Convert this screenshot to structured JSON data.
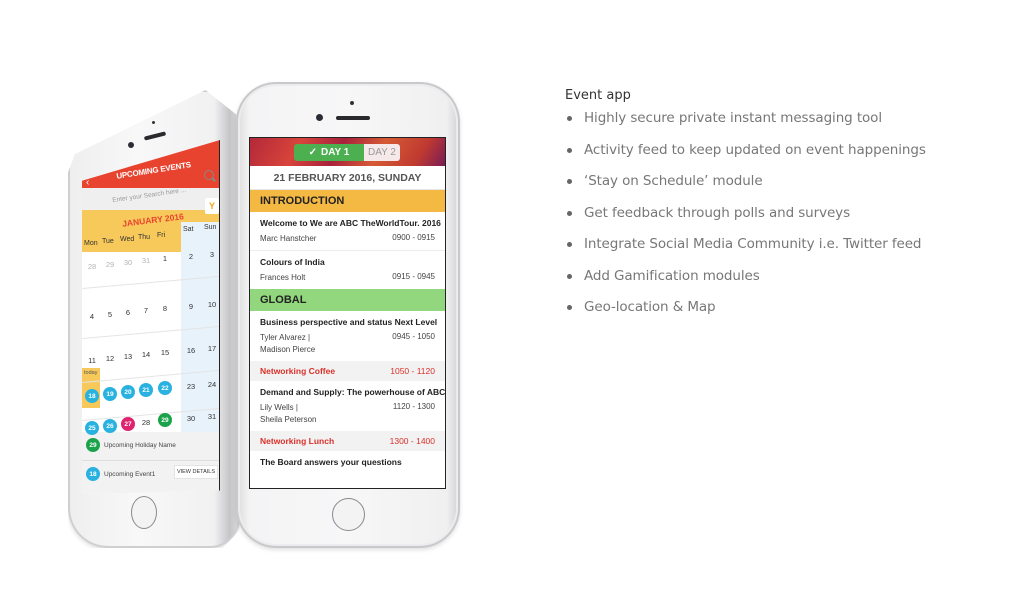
{
  "features": {
    "title": "Event app",
    "items": [
      "Highly secure private instant messaging tool",
      "Activity feed to keep updated on event happenings",
      "‘Stay on Schedule’ module",
      "Get feedback through polls and surveys",
      "Integrate Social Media Community i.e. Twitter feed",
      "Add Gamification modules",
      "Geo-location & Map"
    ]
  },
  "schedule_app": {
    "tabs": {
      "day1": "DAY 1",
      "day2": "DAY 2",
      "active": "DAY 1",
      "check_icon": "✓"
    },
    "date": "21 FEBRUARY 2016, SUNDAY",
    "sections": [
      {
        "name": "INTRODUCTION",
        "color": "#f4b942"
      },
      {
        "name": "GLOBAL",
        "color": "#92d67d"
      }
    ],
    "sessions": [
      {
        "title": "Welcome to We are ABC TheWorldTour. 2016",
        "speakers": "Marc Hanstcher",
        "time": "0900 - 0915"
      },
      {
        "title": "Colours of India",
        "speakers": "Frances Holt",
        "time": "0915 - 0945"
      },
      {
        "title": "Business perspective and status Next Level",
        "speaker1": "Tyler Alvarez |",
        "speaker2": "Madison Pierce",
        "time": "0945 - 1050"
      },
      {
        "title": "Demand and Supply: The powerhouse of ABC",
        "speaker1": "Lily Wells |",
        "speaker2": "Sheila Peterson",
        "time": "1120 - 1300"
      },
      {
        "title": "The Board answers your questions"
      }
    ],
    "breaks": [
      {
        "title": "Networking Coffee",
        "time": "1050 - 1120"
      },
      {
        "title": "Networking Lunch",
        "time": "1300 - 1400"
      }
    ]
  },
  "calendar_app": {
    "title": "UPCOMING EVENTS",
    "back_icon": "‹",
    "search_placeholder": "Enter your Search here ...",
    "month": "JANUARY 2016",
    "filter_icon": "Y",
    "weekdays": [
      "Mon",
      "Tue",
      "Wed",
      "Thu",
      "Fri",
      "Sat",
      "Sun"
    ],
    "weeks": [
      [
        "28",
        "29",
        "30",
        "31",
        "1",
        "2",
        "3"
      ],
      [
        "4",
        "5",
        "6",
        "7",
        "8",
        "9",
        "10"
      ],
      [
        "11",
        "12",
        "13",
        "14",
        "15",
        "16",
        "17"
      ],
      [
        "18",
        "19",
        "20",
        "21",
        "22",
        "23",
        "24"
      ],
      [
        "25",
        "26",
        "27",
        "28",
        "29",
        "30",
        "31"
      ]
    ],
    "today_label": "today",
    "badge_colors": {
      "event": "#29b2e0",
      "holiday": "#1aa34a",
      "special": "#e0236e"
    },
    "footer": {
      "holiday": {
        "date": "29",
        "label": "Upcoming Holiday Name"
      },
      "event": {
        "date": "18",
        "label": "Upcoming Event1"
      },
      "view_details": "VIEW DETAILS"
    }
  }
}
